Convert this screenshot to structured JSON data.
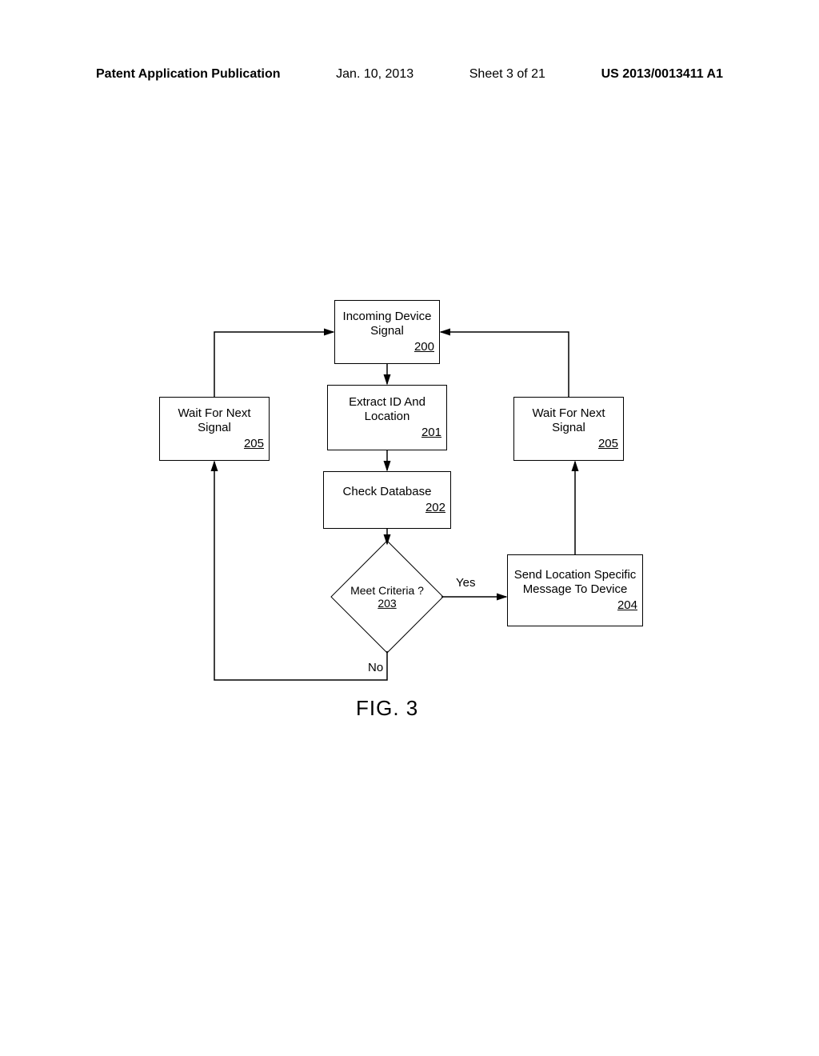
{
  "header": {
    "publication": "Patent Application Publication",
    "date": "Jan. 10, 2013",
    "sheet": "Sheet 3 of 21",
    "pubnum": "US 2013/0013411 A1"
  },
  "figure_label": "FIG. 3",
  "nodes": {
    "n200": {
      "text": "Incoming Device Signal",
      "ref": "200"
    },
    "n201": {
      "text": "Extract ID And Location",
      "ref": "201"
    },
    "n202": {
      "text": "Check Database",
      "ref": "202"
    },
    "n203": {
      "text": "Meet Criteria ?",
      "ref": "203"
    },
    "n204": {
      "text": "Send Location Specific Message To Device",
      "ref": "204"
    },
    "n205_left": {
      "text": "Wait For Next Signal",
      "ref": "205"
    },
    "n205_right": {
      "text": "Wait For Next Signal",
      "ref": "205"
    }
  },
  "branches": {
    "yes": "Yes",
    "no": "No"
  },
  "chart_data": {
    "type": "flowchart",
    "title": "FIG. 3",
    "nodes": [
      {
        "id": "200",
        "type": "process",
        "label": "Incoming Device Signal"
      },
      {
        "id": "201",
        "type": "process",
        "label": "Extract ID And Location"
      },
      {
        "id": "202",
        "type": "process",
        "label": "Check Database"
      },
      {
        "id": "203",
        "type": "decision",
        "label": "Meet Criteria ?"
      },
      {
        "id": "204",
        "type": "process",
        "label": "Send Location Specific Message To Device"
      },
      {
        "id": "205L",
        "type": "process",
        "label": "Wait For Next Signal"
      },
      {
        "id": "205R",
        "type": "process",
        "label": "Wait For Next Signal"
      }
    ],
    "edges": [
      {
        "from": "200",
        "to": "201"
      },
      {
        "from": "201",
        "to": "202"
      },
      {
        "from": "202",
        "to": "203"
      },
      {
        "from": "203",
        "to": "204",
        "label": "Yes"
      },
      {
        "from": "203",
        "to": "205L",
        "label": "No"
      },
      {
        "from": "204",
        "to": "205R"
      },
      {
        "from": "205L",
        "to": "200"
      },
      {
        "from": "205R",
        "to": "200"
      }
    ]
  }
}
